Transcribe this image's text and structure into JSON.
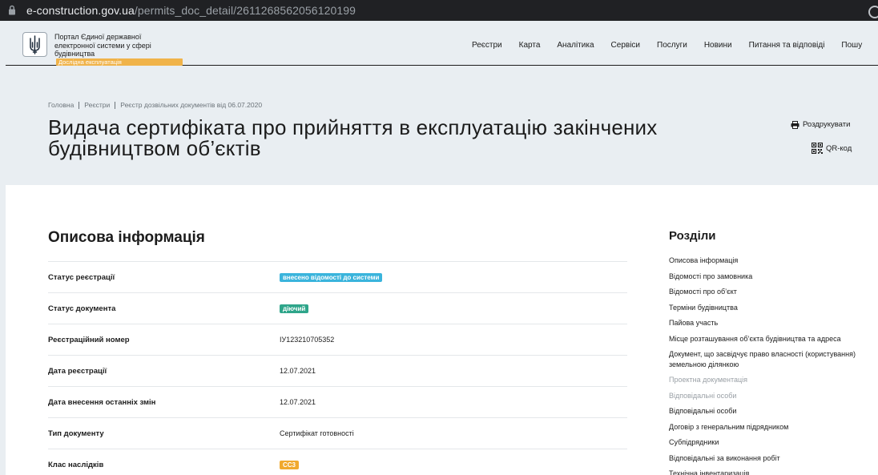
{
  "browser": {
    "url_host": "e-construction.gov.ua",
    "url_path": "/permits_doc_detail/2611268562056120199"
  },
  "header": {
    "portal_name_lines": [
      "Портал Єдиної державної",
      "електронної системи у сфері",
      "будівництва"
    ],
    "badge": "Дослідна експлуатація",
    "nav": [
      "Реєстри",
      "Карта",
      "Аналітика",
      "Сервіси",
      "Послуги",
      "Новини",
      "Питання та відповіді",
      "Пошу"
    ]
  },
  "breadcrumb": [
    "Головна",
    "Реєстри",
    "Реєстр дозвільних документів від 06.07.2020"
  ],
  "page": {
    "title": "Видача сертифіката про прийняття в експлуатацію закінчених будівництвом об’єктів",
    "print_label": "Роздрукувати",
    "qr_label": "QR-код"
  },
  "info": {
    "title": "Описова інформація",
    "rows": [
      {
        "label": "Статус реєстрації",
        "value": "внесено відомості до системи",
        "chip_color": "#3ab4dc"
      },
      {
        "label": "Статус документа",
        "value": "діючий",
        "chip_color": "#2ea58a"
      },
      {
        "label": "Реєстраційний номер",
        "value": "ІУ123210705352"
      },
      {
        "label": "Дата реєстрації",
        "value": "12.07.2021"
      },
      {
        "label": "Дата внесення останніх змін",
        "value": "12.07.2021"
      },
      {
        "label": "Тип документу",
        "value": "Сертифікат готовності"
      },
      {
        "label": "Клас наслідків",
        "value": "СС3",
        "chip_color": "#f0a92e"
      }
    ]
  },
  "toc": {
    "title": "Розділи",
    "items": [
      {
        "label": "Описова інформація"
      },
      {
        "label": "Відомості про замовника"
      },
      {
        "label": "Відомості про об’єкт"
      },
      {
        "label": "Терміни будівництва"
      },
      {
        "label": "Пайова участь"
      },
      {
        "label": "Місце розташування об’єкта будівництва та адреса"
      },
      {
        "label": "Документ, що засвідчує право власності (користування) земельною ділянкою"
      },
      {
        "label": "Проектна документація",
        "dim": true
      },
      {
        "label": "Відповідальні особи",
        "dim": true
      },
      {
        "label": "Відповідальні особи"
      },
      {
        "label": "Договір з генеральним підрядником"
      },
      {
        "label": "Субпідрядники"
      },
      {
        "label": "Відповідальні за виконання робіт"
      },
      {
        "label": "Технічна інвентаризація"
      }
    ]
  }
}
